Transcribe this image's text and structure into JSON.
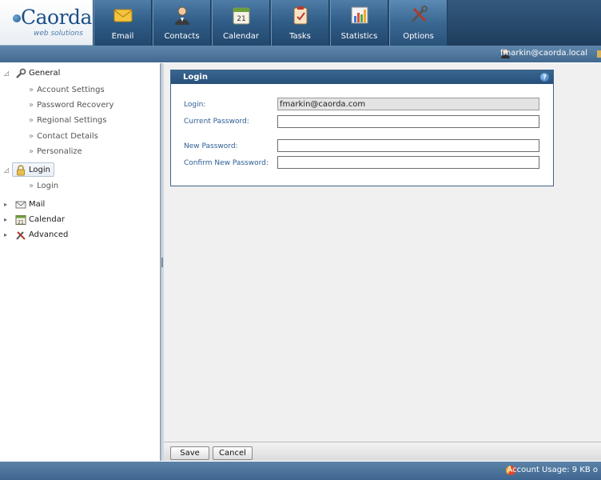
{
  "brand": {
    "name": "Caorda",
    "tagline": "web solutions"
  },
  "nav": {
    "tabs": [
      {
        "label": "Email",
        "icon": "envelope-icon"
      },
      {
        "label": "Contacts",
        "icon": "person-icon"
      },
      {
        "label": "Calendar",
        "icon": "calendar-icon"
      },
      {
        "label": "Tasks",
        "icon": "clipboard-icon"
      },
      {
        "label": "Statistics",
        "icon": "bar-chart-icon"
      },
      {
        "label": "Options",
        "icon": "tools-icon",
        "active": true
      }
    ]
  },
  "user": {
    "email": "fmarkin@caorda.local"
  },
  "sidebar": {
    "groups": [
      {
        "label": "General",
        "icon": "wrench-icon",
        "expanded": true,
        "items": [
          "Account Settings",
          "Password Recovery",
          "Regional Settings",
          "Contact Details",
          "Personalize"
        ]
      },
      {
        "label": "Login",
        "icon": "lock-icon",
        "expanded": true,
        "selected": true,
        "items": [
          "Login"
        ]
      },
      {
        "label": "Mail",
        "icon": "envelope-icon",
        "expanded": false
      },
      {
        "label": "Calendar",
        "icon": "calendar-icon",
        "expanded": false
      },
      {
        "label": "Advanced",
        "icon": "tools-icon",
        "expanded": false
      }
    ]
  },
  "panel": {
    "title": "Login",
    "help": "?",
    "fields": {
      "login_label": "Login:",
      "login_value": "fmarkin@caorda.com",
      "current_password_label": "Current Password:",
      "new_password_label": "New Password:",
      "confirm_password_label": "Confirm New Password:"
    }
  },
  "toolbar": {
    "save_label": "Save",
    "cancel_label": "Cancel"
  },
  "footer": {
    "usage": "Account Usage: 9 KB o"
  }
}
